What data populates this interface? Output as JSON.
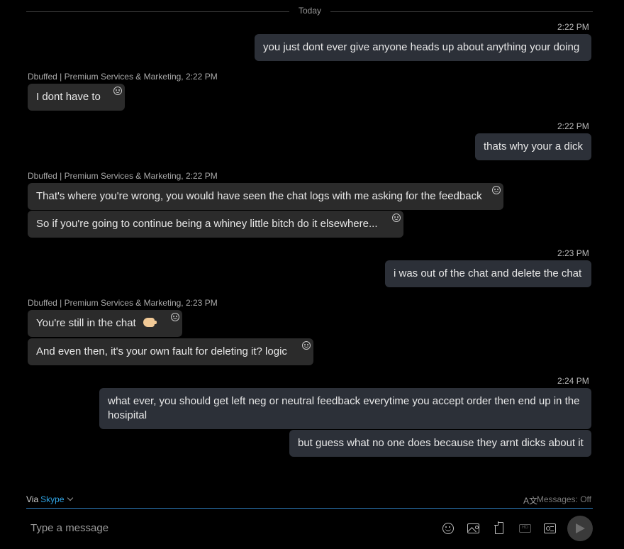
{
  "day_divider": "Today",
  "messages": [
    {
      "time": "2:22 PM",
      "text": "you just dont ever give anyone heads up about anything your doing"
    },
    {
      "sender": "Dbuffed | Premium Services & Marketing,",
      "time": "2:22 PM",
      "text": "I dont have to"
    },
    {
      "time": "2:22 PM",
      "text": "thats why your a dick"
    },
    {
      "sender": "Dbuffed | Premium Services & Marketing,",
      "time": "2:22 PM",
      "text": "That's where you're wrong, you would have seen the chat logs with me asking for the feedback"
    },
    {
      "text": "So if you're going to continue being a whiney little bitch do it elsewhere..."
    },
    {
      "time": "2:23 PM",
      "text": "i was out of the chat and delete the chat"
    },
    {
      "sender": "Dbuffed | Premium Services & Marketing,",
      "time": "2:23 PM",
      "text": "You're still in the chat",
      "emoji": "pointing-hand-emoji"
    },
    {
      "text": "And even then, it's your own fault for deleting it? logic"
    },
    {
      "time": "2:24 PM",
      "text": "what ever, you should get left neg or neutral feedback everytime you accept order then end up in the hosipital"
    },
    {
      "text": "but guess what no one does because they arnt dicks about it"
    }
  ],
  "footer": {
    "via_label": "Via",
    "via_service": "Skype",
    "translate_icon": "A文",
    "messages_status": "Messages: Off"
  },
  "composer": {
    "placeholder": "Type a message",
    "video_icon_text": "HD"
  },
  "colors": {
    "outgoing_bubble": "#2c3038",
    "incoming_bubble": "#2b2b2b",
    "accent": "#2fa3e3"
  }
}
